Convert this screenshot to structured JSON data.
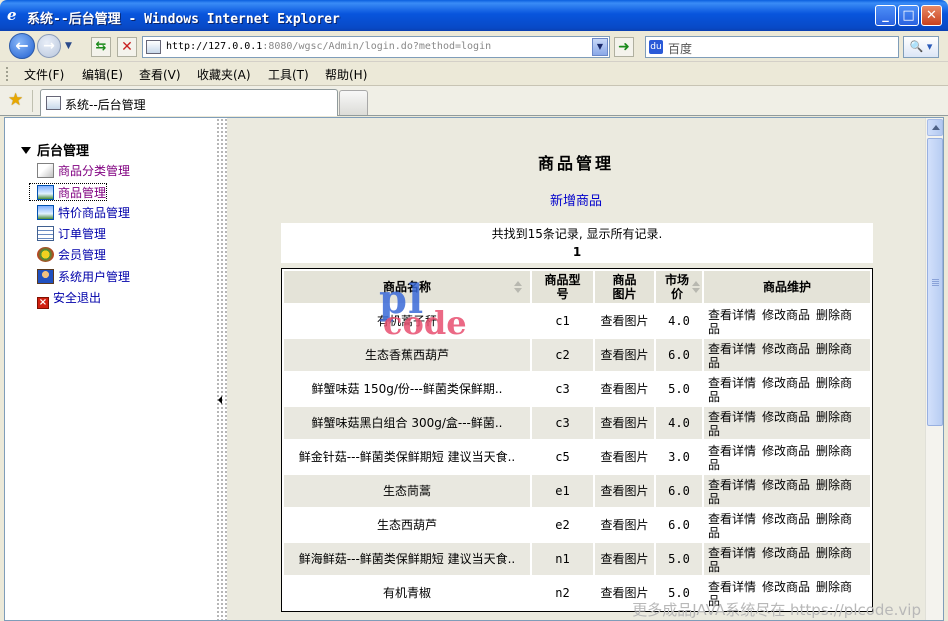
{
  "window": {
    "title": "系统--后台管理 - Windows Internet Explorer",
    "min_label": "_",
    "max_label": "□",
    "close_label": "✕"
  },
  "addressbar": {
    "url_host": "http://127.0.0.1",
    "url_rest": ":8080/wgsc/Admin/login.do?method=login",
    "search_placeholder": "百度",
    "search_btn_label": "🔍 ▾"
  },
  "menubar": {
    "items": [
      "文件(F)",
      "编辑(E)",
      "查看(V)",
      "收藏夹(A)",
      "工具(T)",
      "帮助(H)"
    ]
  },
  "tab": {
    "label": "系统--后台管理"
  },
  "sidebar": {
    "root_label": "后台管理",
    "items": [
      {
        "label": "商品分类管理",
        "icon": "category-icon"
      },
      {
        "label": "商品管理",
        "icon": "picture-icon"
      },
      {
        "label": "特价商品管理",
        "icon": "picture-icon"
      },
      {
        "label": "订单管理",
        "icon": "document-icon"
      },
      {
        "label": "会员管理",
        "icon": "member-icon"
      },
      {
        "label": "系统用户管理",
        "icon": "user-icon"
      },
      {
        "label": "安全退出",
        "icon": "exit-icon"
      }
    ]
  },
  "main": {
    "title": "商品管理",
    "add_link": "新增商品",
    "summary": "共找到15条记录, 显示所有记录.",
    "page": "1",
    "columns": [
      "商品名称",
      "商品型号",
      "商品图片",
      "市场价",
      "商品维护"
    ],
    "view_image_label": "查看图片",
    "ops": [
      "查看详情",
      "修改商品",
      "删除商品"
    ],
    "rows": [
      {
        "name": "有机蒿子秆",
        "model": "c1",
        "price": "4.0"
      },
      {
        "name": "生态香蕉西葫芦",
        "model": "c2",
        "price": "6.0"
      },
      {
        "name": "鲜蟹味菇 150g/份---鲜菌类保鲜期..",
        "model": "c3",
        "price": "5.0"
      },
      {
        "name": "鲜蟹味菇黑白组合 300g/盒---鲜菌..",
        "model": "c3",
        "price": "4.0"
      },
      {
        "name": "鲜金针菇---鲜菌类保鲜期短 建议当天食..",
        "model": "c5",
        "price": "3.0"
      },
      {
        "name": "生态茼蒿",
        "model": "e1",
        "price": "6.0"
      },
      {
        "name": "生态西葫芦",
        "model": "e2",
        "price": "6.0"
      },
      {
        "name": "鲜海鲜菇---鲜菌类保鲜期短 建议当天食..",
        "model": "n1",
        "price": "5.0"
      },
      {
        "name": "有机青椒",
        "model": "n2",
        "price": "5.0"
      }
    ]
  },
  "watermark": {
    "line1": "pl",
    "line2": "code",
    "footer": "更多成品JAVA系统尽在 https://plcode.vip"
  },
  "colors": {
    "titlebar": "#0855dd",
    "link": "#0000cc",
    "visited": "#800080",
    "header_bg": "#e4e3d8"
  }
}
